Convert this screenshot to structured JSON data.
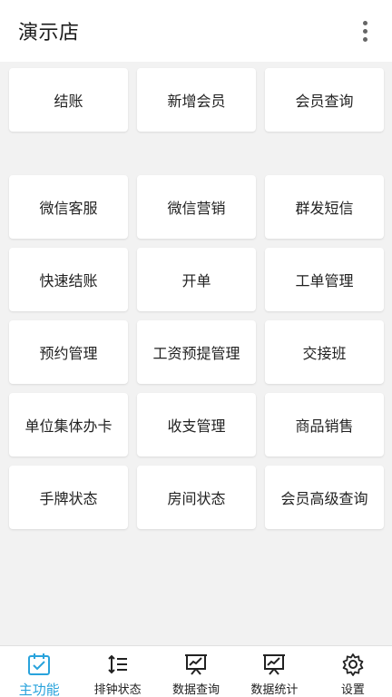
{
  "header": {
    "title": "演示店",
    "more_icon": "more-vertical-icon"
  },
  "top_tiles": [
    {
      "label": "结账"
    },
    {
      "label": "新增会员"
    },
    {
      "label": "会员查询"
    }
  ],
  "main_tiles": [
    {
      "label": "微信客服"
    },
    {
      "label": "微信营销"
    },
    {
      "label": "群发短信"
    },
    {
      "label": "快速结账"
    },
    {
      "label": "开单"
    },
    {
      "label": "工单管理"
    },
    {
      "label": "预约管理"
    },
    {
      "label": "工资预提管理"
    },
    {
      "label": "交接班"
    },
    {
      "label": "单位集体办卡"
    },
    {
      "label": "收支管理"
    },
    {
      "label": "商品销售"
    },
    {
      "label": "手牌状态"
    },
    {
      "label": "房间状态"
    },
    {
      "label": "会员高级查询"
    }
  ],
  "bottom_nav": [
    {
      "label": "主功能",
      "icon": "calendar-check-icon",
      "active": true
    },
    {
      "label": "排钟状态",
      "icon": "sort-list-icon",
      "active": false
    },
    {
      "label": "数据查询",
      "icon": "chart-board-icon",
      "active": false
    },
    {
      "label": "数据统计",
      "icon": "chart-board-icon",
      "active": false
    },
    {
      "label": "设置",
      "icon": "gear-icon",
      "active": false
    }
  ],
  "colors": {
    "accent": "#29a3dc",
    "background": "#f2f2f2",
    "tile": "#ffffff"
  }
}
